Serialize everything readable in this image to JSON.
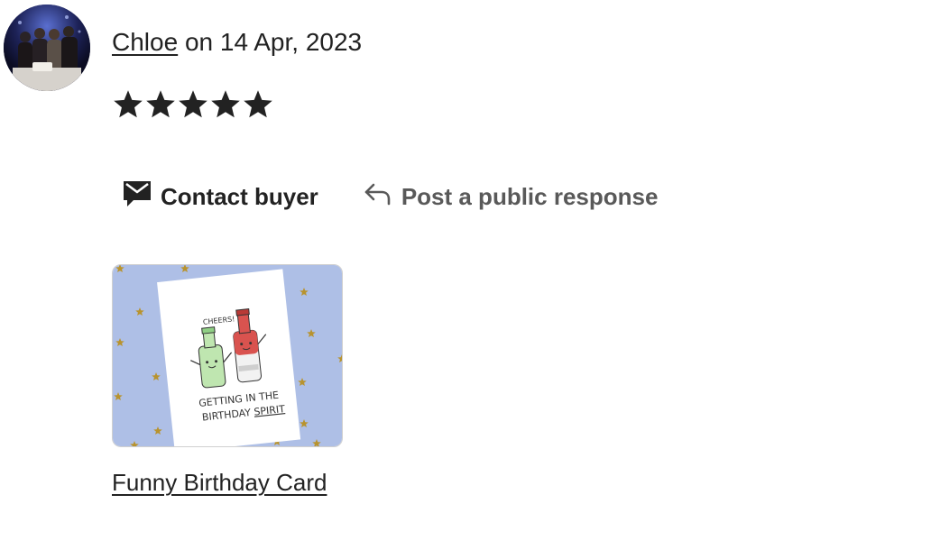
{
  "review": {
    "reviewer_name": "Chloe",
    "date_text": " on 14 Apr, 2023",
    "rating": 5,
    "rating_max": 5
  },
  "actions": {
    "contact_label": "Contact buyer",
    "respond_label": "Post a public response"
  },
  "listing": {
    "title": "Funny Birthday Card",
    "image_alt": "Funny Birthday Card",
    "card_text_line1": "GETTING IN THE",
    "card_text_line2": "BIRTHDAY",
    "card_text_line2_underlined": "SPIRIT",
    "card_bubble": "CHEERS!"
  },
  "icons": {
    "avatar": "avatar-photo",
    "star": "star-icon",
    "contact": "envelope-icon",
    "respond": "reply-arrow-icon"
  },
  "colors": {
    "text": "#222222",
    "muted_text": "#595959",
    "star": "#222222",
    "card_background": "#aebfe6",
    "confetti_star": "#b8932e"
  }
}
